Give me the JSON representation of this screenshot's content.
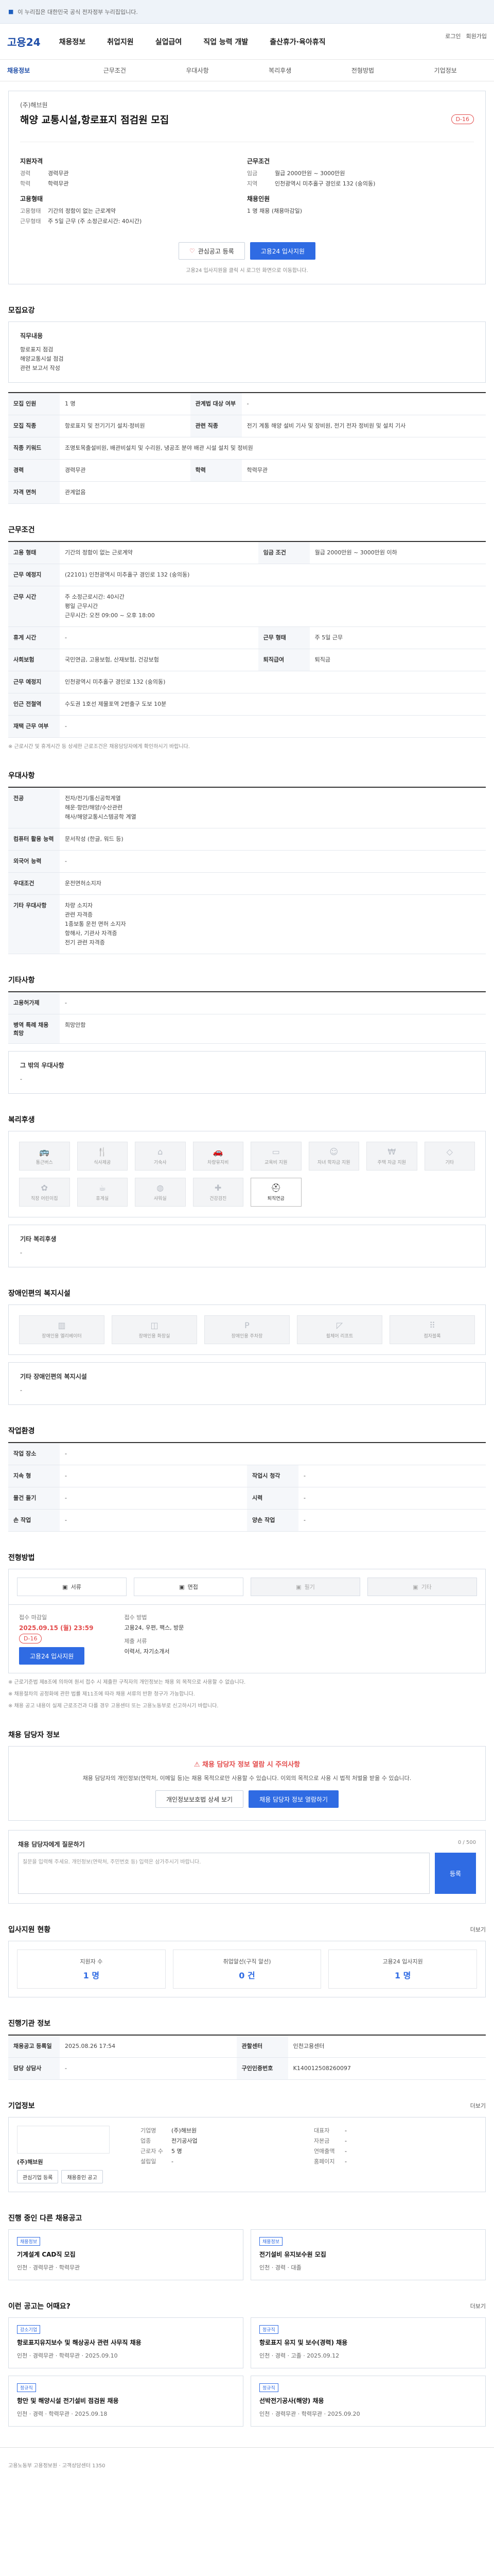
{
  "topbar": {
    "text": "이 누리집은 대한민국 공식 전자정부 누리집입니다."
  },
  "header": {
    "logo": "고용24",
    "nav": [
      "채용정보",
      "취업지원",
      "실업급여",
      "직업 능력 개발",
      "출산휴가·육아휴직"
    ],
    "right": [
      "로그인",
      "회원가입"
    ]
  },
  "subnav": [
    "채용정보",
    "근무조건",
    "우대사항",
    "복리후생",
    "전형방법",
    "기업정보"
  ],
  "job": {
    "company": "(주)해브원",
    "title": "해양 교통시설,항로표지 점검원 모집",
    "dday": "D-16",
    "left_title": "지원자격",
    "left_rows": [
      {
        "k": "경력",
        "v": "경력무관"
      },
      {
        "k": "학력",
        "v": "학력무관"
      }
    ],
    "left_title2": "고용형태",
    "left_rows2": [
      {
        "k": "고용형태",
        "v": "기간의 정함이 없는 근로계약"
      },
      {
        "k": "근무형태",
        "v": "주 5일 근무 (주 소정근로시간: 40시간)"
      }
    ],
    "right_title": "근무조건",
    "right_rows": [
      {
        "k": "임금",
        "v": "월급 2000만원 ~ 3000만원"
      },
      {
        "k": "지역",
        "v": "인천광역시 미추홀구 경인로 132 (숭의동)"
      }
    ],
    "right_title2": "채용인원",
    "right_rows2": [
      {
        "k": "",
        "v": "1 명 채용 (채용마감일)"
      }
    ],
    "btn_scrap": "관심공고 등록",
    "btn_apply": "고용24 입사지원",
    "note": "고용24 입사지원을 클릭 시 로그인 화면으로 이동합니다."
  },
  "recruit": {
    "title": "모집요강",
    "desc_title": "직무내용",
    "desc": [
      "항로표지 점검",
      "해양교통시설 점검",
      "관련 보고서 작성"
    ],
    "rows": [
      {
        "k": "모집 인원",
        "v": "1 명",
        "k2": "관계법 대상 여부",
        "v2": "-"
      },
      {
        "k": "모집 직종",
        "v": "항로표지 및 전기기기 설치·정비원",
        "k2": "관련 직종",
        "v2": "전기 계통 해양 설비 기사 및 장비원, 전기 전자 정비원 및 설치 기사"
      },
      {
        "k": "직종 키워드",
        "v": "조명토목출설비원, 배관비설치 및 수리원, 냉공조 분야 배관 시설 설치 및 정비원",
        "k2": "",
        "v2": ""
      },
      {
        "k": "경력",
        "v": "경력무관",
        "k2": "학력",
        "v2": "학력무관"
      },
      {
        "k": "자격 면허",
        "v": "관계없음",
        "k2": "",
        "v2": ""
      }
    ]
  },
  "conditions": {
    "title": "근무조건",
    "rows": [
      {
        "k": "고용 형태",
        "v": "기간의 정함이 없는 근로계약",
        "k2": "임금 조건",
        "v2": "월급 2000만원 ~ 3000만원 이하"
      },
      {
        "k": "근무 예정지",
        "v": "(22101) 인천광역시 미추홀구 경인로 132 (숭의동)",
        "k2": "",
        "v2": ""
      },
      {
        "k": "근무 시간",
        "v": "주 소정근로시간: 40시간\n평일 근무시간\n근무시간: 오전 09:00 ~ 오후 18:00",
        "k2": "",
        "v2": ""
      },
      {
        "k": "휴게 시간",
        "v": "-",
        "k2": "근무 형태",
        "v2": "주 5일 근무"
      },
      {
        "k": "사회보험",
        "v": "국민연금, 고용보험, 산재보험, 건강보험",
        "k2": "퇴직급여",
        "v2": "퇴직금"
      },
      {
        "k": "근무 예정지",
        "v": "인천광역시 미추홀구 경인로 132 (숭의동)",
        "k2": "",
        "v2": ""
      },
      {
        "k": "인근 전철역",
        "v": "수도권 1호선 제물포역 2번출구 도보 10분",
        "k2": "",
        "v2": ""
      },
      {
        "k": "재택 근무 여부",
        "v": "-",
        "k2": "",
        "v2": ""
      }
    ],
    "note": "※ 근로시간 및 휴게시간 등 상세한 근로조건은 채용담당자에게 확인하시기 바랍니다."
  },
  "prefer": {
    "title": "우대사항",
    "rows": [
      {
        "k": "전공",
        "v": "전자/전기/통신공학계열\n해운·항만/해양/수산관련\n해사/해양교통시스템공학 계열"
      },
      {
        "k": "컴퓨터 활용 능력",
        "v": "문서작성 (한글, 워드 등)"
      },
      {
        "k": "외국어 능력",
        "v": "-"
      },
      {
        "k": "우대조건",
        "v": "운전면허소지자"
      },
      {
        "k": "기타 우대사항",
        "v": "차량 소지자\n관련 자격증\n1종보통 운전 면허 소지자\n항해사, 기관사 자격증\n전기 관련 자격증"
      }
    ]
  },
  "etc": {
    "title": "기타사항",
    "rows": [
      {
        "k": "고용허가제",
        "v": "-"
      },
      {
        "k": "병역 특례 채용 희망",
        "v": "희망안함"
      },
      {
        "k": "그 밖의 우대사항",
        "v": "-"
      }
    ]
  },
  "welfare": {
    "title": "복리후생",
    "tiles": [
      {
        "icon": "bus-icon",
        "glyph": "🚌",
        "label": "통근버스",
        "on": false
      },
      {
        "icon": "meal-icon",
        "glyph": "🍴",
        "label": "식사제공",
        "on": false
      },
      {
        "icon": "house-icon",
        "glyph": "⌂",
        "label": "기숙사",
        "on": false
      },
      {
        "icon": "car-icon",
        "glyph": "🚗",
        "label": "차량유지비",
        "on": false
      },
      {
        "icon": "book-icon",
        "glyph": "▭",
        "label": "교육비 지원",
        "on": false
      },
      {
        "icon": "child-icon",
        "glyph": "☺",
        "label": "자녀 학자금 지원",
        "on": false
      },
      {
        "icon": "loan-icon",
        "glyph": "₩",
        "label": "주택 자금 지원",
        "on": false
      },
      {
        "icon": "gift-icon",
        "glyph": "◇",
        "label": "기타",
        "on": false
      },
      {
        "icon": "nursery-icon",
        "glyph": "✿",
        "label": "직장 어린이집",
        "on": false
      },
      {
        "icon": "rest-icon",
        "glyph": "☕",
        "label": "휴게실",
        "on": false
      },
      {
        "icon": "bath-icon",
        "glyph": "◍",
        "label": "샤워실",
        "on": false
      },
      {
        "icon": "health-icon",
        "glyph": "✚",
        "label": "건강검진",
        "on": false
      },
      {
        "icon": "accident-icon",
        "glyph": "⛑",
        "label": "퇴직연금",
        "on": true
      }
    ],
    "etc_label": "기타 복리후생",
    "etc_value": "-"
  },
  "disability": {
    "title": "장애인편의 복지시설",
    "tiles": [
      {
        "icon": "elevator-icon",
        "glyph": "▥",
        "label": "장애인용 엘리베이터"
      },
      {
        "icon": "restroom-icon",
        "glyph": "◫",
        "label": "장애인용 화장실"
      },
      {
        "icon": "parking-icon",
        "glyph": "P",
        "label": "장애인용 주차장"
      },
      {
        "icon": "ramp-icon",
        "glyph": "◸",
        "label": "휠체어 리프트"
      },
      {
        "icon": "braille-icon",
        "glyph": "⠿",
        "label": "점자블록"
      }
    ],
    "etc_label": "기타 장애인편의 복지시설",
    "etc_value": "-"
  },
  "disabled_req": {
    "title": "작업환경",
    "rows": [
      {
        "k": "작업 장소",
        "v": "-",
        "k2": "",
        "v2": ""
      },
      {
        "k": "지속 형",
        "v": "-",
        "k2": "작업시 청각",
        "v2": "-"
      },
      {
        "k": "물건 들기",
        "v": "-",
        "k2": "시력",
        "v2": "-"
      },
      {
        "k": "손 작업",
        "v": "-",
        "k2": "양손 작업",
        "v2": "-"
      }
    ]
  },
  "apply": {
    "title": "전형방법",
    "methods": [
      {
        "icon": "document-icon",
        "label": "서류",
        "off": false
      },
      {
        "icon": "interview-icon",
        "label": "면접",
        "off": false
      },
      {
        "icon": "test-icon",
        "label": "필기",
        "off": true
      },
      {
        "icon": "etc-icon",
        "label": "기타",
        "off": true
      }
    ],
    "period_label": "접수 마감일",
    "period": "2025.09.15 (월) 23:59",
    "dday": "D-16",
    "apply_way_label": "접수 방법",
    "apply_way": "고용24, 우편, 팩스, 방문",
    "docs_label": "제출 서류",
    "docs": "이력서, 자기소개서",
    "btn": "고용24 입사지원",
    "notes": [
      "※ 근로기준법 제8조에 의하여 원서 접수 시 제출한 구직자의 개인정보는 채용 외 목적으로 사용할 수 없습니다.",
      "※ 채용절차의 공정화에 관한 법률 제11조에 따라 채용 서류의 반환 청구가 가능합니다.",
      "※ 채용 공고 내용이 실제 근로조건과 다를 경우 고용센터 또는 고용노동부로 신고하시기 바랍니다."
    ]
  },
  "warning": {
    "title": "채용 담당자 정보",
    "w_title": "⚠ 채용 담당자 정보 열람 시 주의사항",
    "w_desc": "채용 담당자의 개인정보(연락처, 이메일 등)는 채용 목적으로만 사용할 수 있습니다. 이외의 목적으로 사용 시 법적 처벌을 받을 수 있습니다.",
    "btn1": "개인정보보호법 상세 보기",
    "btn2": "채용 담당자 정보 열람하기"
  },
  "inquiry": {
    "title": "채용 담당자에게 질문하기",
    "placeholder": "질문을 입력해 주세요. 개인정보(연락처, 주민번호 등) 입력은 삼가주시기 바랍니다.",
    "count": "0 / 500",
    "btn": "등록"
  },
  "stats": {
    "title": "입사지원 현황",
    "more": "더보기",
    "items": [
      {
        "label": "지원자 수",
        "value": "1 명"
      },
      {
        "label": "취업알선(구직 알선)",
        "value": "0 건"
      },
      {
        "label": "고용24 입사지원",
        "value": "1 명"
      }
    ]
  },
  "manage": {
    "title": "진행기관 정보",
    "rows": [
      {
        "k": "채용공고 등록일",
        "v": "2025.08.26 17:54",
        "k2": "관할센터",
        "v2": "인천고용센터"
      },
      {
        "k": "담당 상담사",
        "v": "-",
        "k2": "구인인증번호",
        "v2": "K140012508260097"
      }
    ]
  },
  "companyinfo": {
    "title": "기업정보",
    "more": "더보기",
    "name": "(주)해브원",
    "rows": [
      {
        "k": "기업명",
        "v": "(주)해브원"
      },
      {
        "k": "업종",
        "v": "전기공사업"
      },
      {
        "k": "근로자 수",
        "v": "5 명"
      },
      {
        "k": "설립일",
        "v": "-"
      }
    ],
    "rows2": [
      {
        "k": "대표자",
        "v": "-"
      },
      {
        "k": "자본금",
        "v": "-"
      },
      {
        "k": "연매출액",
        "v": "-"
      },
      {
        "k": "홈페이지",
        "v": "-"
      }
    ],
    "btn1": "관심기업 등록",
    "btn2": "채용중인 공고"
  },
  "similar": {
    "title": "진행 중인 다른 채용공고",
    "card1": {
      "badge": "채용정보",
      "title": "기계설계 CAD직 모집",
      "meta": "인천 · 경력무관 · 학력무관"
    },
    "card2": {
      "badge": "채용정보",
      "title": "전기설비 유지보수원 모집",
      "meta": "인천 · 경력 · 대졸"
    }
  },
  "recommend": {
    "title": "이런 공고는 어때요?",
    "more": "더보기",
    "cards": [
      {
        "badge": "강소기업",
        "title": "항로표지유지보수 및 해상공사 관련 사무직 채용",
        "meta": "인천 · 경력무관 · 학력무관 · 2025.09.10"
      },
      {
        "badge": "정규직",
        "title": "항로표지 유지 및 보수(경력) 채용",
        "meta": "인천 · 경력 · 고졸 · 2025.09.12"
      },
      {
        "badge": "정규직",
        "title": "항만 및 해양시설 전기설비 점검원 채용",
        "meta": "인천 · 경력 · 학력무관 · 2025.09.18"
      },
      {
        "badge": "정규직",
        "title": "선박전기공사(해양) 채용",
        "meta": "인천 · 경력무관 · 학력무관 · 2025.09.20"
      }
    ]
  },
  "footer": {
    "text": "고용노동부 고용정보원 · 고객상담센터 1350"
  }
}
